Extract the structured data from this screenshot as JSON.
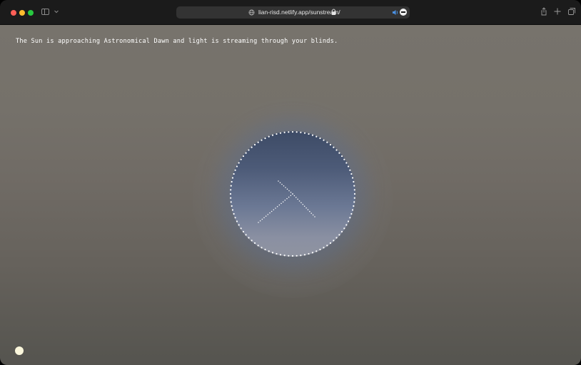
{
  "browser": {
    "url": "lian-risd.netlify.app/sunstream/",
    "icons": {
      "sidebar": "sidebar-icon",
      "chevron": "chevron-down-icon",
      "globe": "globe-icon",
      "lock": "lock-icon",
      "audio": "speaker-icon",
      "extension": "extension-icon",
      "share": "share-icon",
      "new_tab": "plus-icon",
      "tabs": "tab-overview-icon"
    }
  },
  "page": {
    "status_message": "The Sun is approaching Astronomical Dawn and light is streaming through your blinds."
  },
  "colors": {
    "text": "#ffffff",
    "sun": "#fbf7dc",
    "dial_top": "#3d4b66",
    "dial_bottom": "#8f93a0"
  }
}
